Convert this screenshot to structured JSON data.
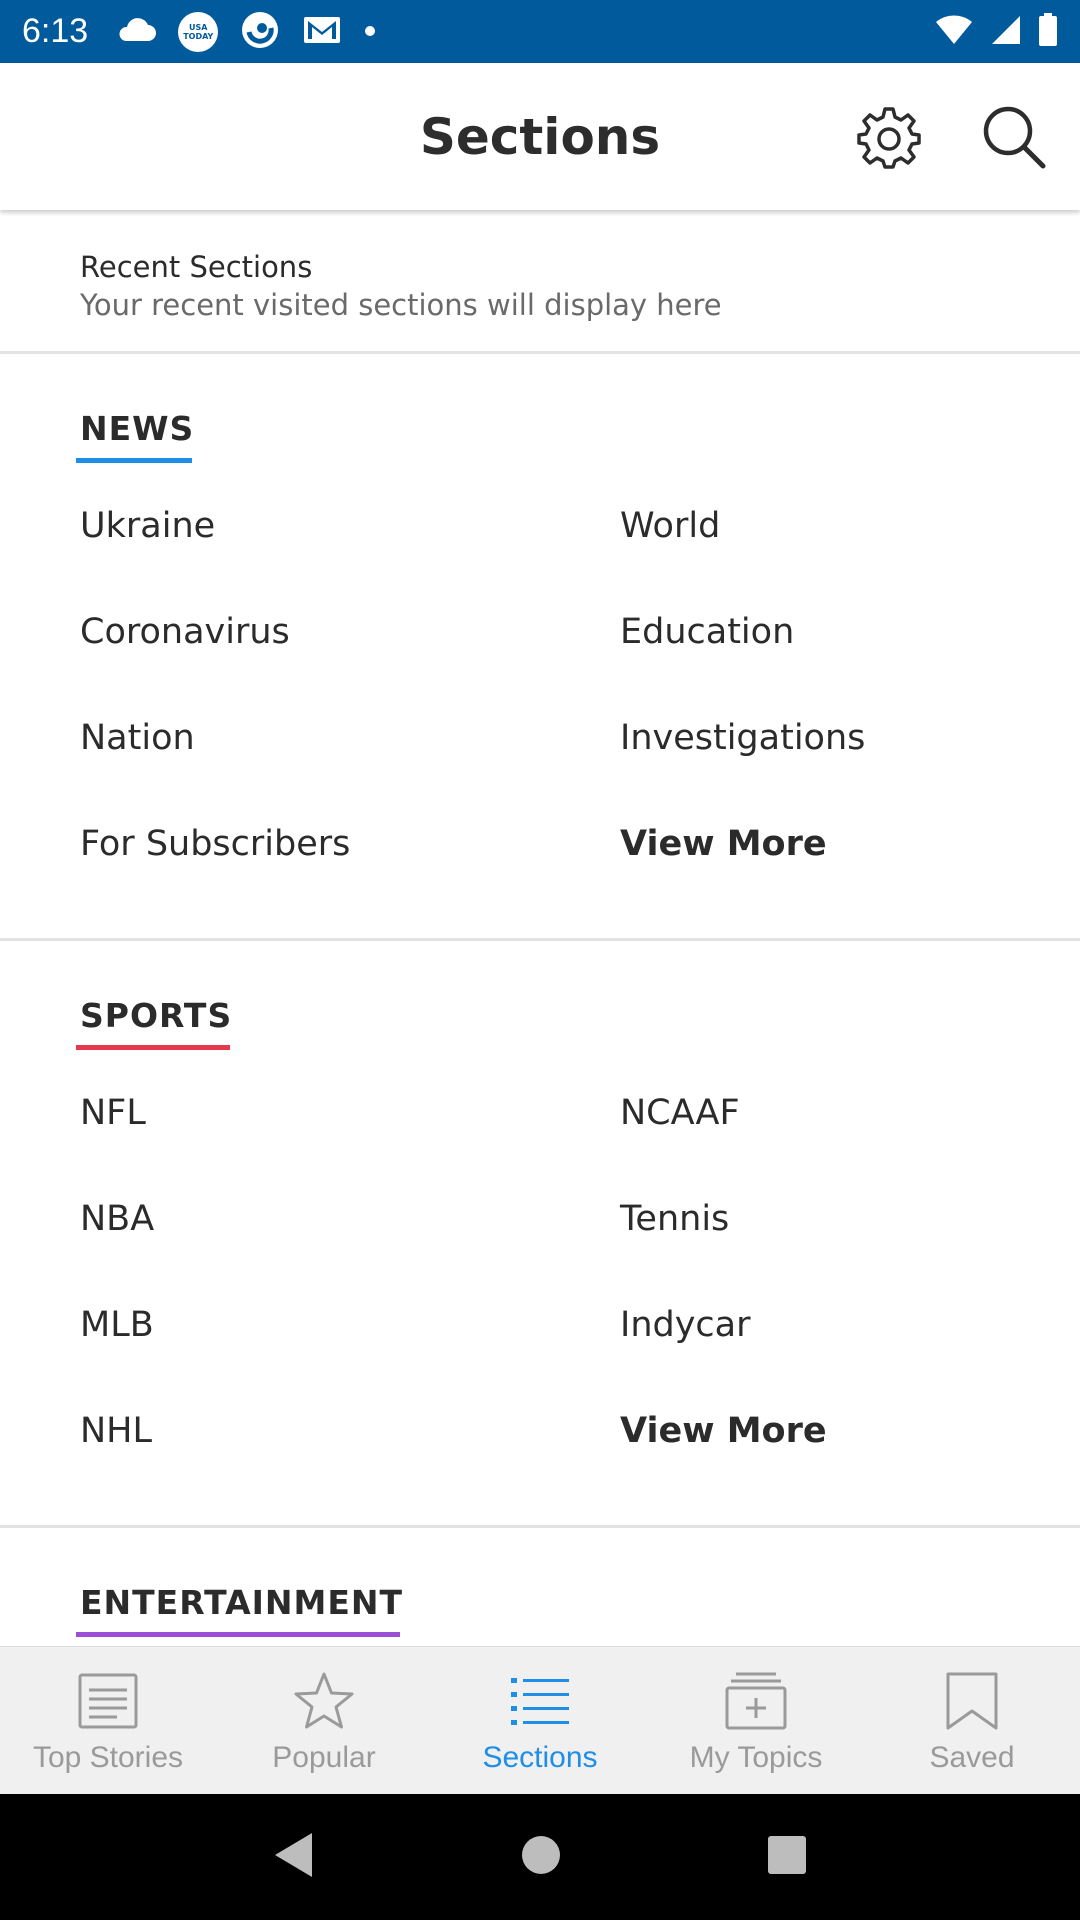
{
  "status_bar": {
    "time": "6:13",
    "icons_left": [
      "cloud-icon",
      "usa-today-icon",
      "browser-icon",
      "gmail-icon",
      "dot-icon"
    ],
    "icons_right": [
      "wifi-icon",
      "signal-icon",
      "battery-icon"
    ],
    "usa_today_text": "USA TODAY"
  },
  "header": {
    "title": "Sections",
    "settings_icon": "gear-icon",
    "search_icon": "search-icon"
  },
  "recent": {
    "title": "Recent Sections",
    "subtitle": "Your recent visited sections will display here"
  },
  "sections": [
    {
      "title": "NEWS",
      "accent": "#1e8ee6",
      "items": [
        "Ukraine",
        "World",
        "Coronavirus",
        "Education",
        "Nation",
        "Investigations",
        "For Subscribers",
        "View More"
      ]
    },
    {
      "title": "SPORTS",
      "accent": "#e8364a",
      "items": [
        "NFL",
        "NCAAF",
        "NBA",
        "Tennis",
        "MLB",
        "Indycar",
        "NHL",
        "View More"
      ]
    },
    {
      "title": "ENTERTAINMENT",
      "accent": "#9b4fd8",
      "items": []
    }
  ],
  "bottom_nav": {
    "items": [
      {
        "label": "Top Stories",
        "icon": "newspaper-icon"
      },
      {
        "label": "Popular",
        "icon": "star-icon"
      },
      {
        "label": "Sections",
        "icon": "list-icon"
      },
      {
        "label": "My Topics",
        "icon": "add-topic-icon"
      },
      {
        "label": "Saved",
        "icon": "bookmark-icon"
      }
    ],
    "active": "Sections",
    "active_color": "#1e8ee6"
  },
  "system_nav": [
    "back-icon",
    "home-icon",
    "recents-icon"
  ]
}
